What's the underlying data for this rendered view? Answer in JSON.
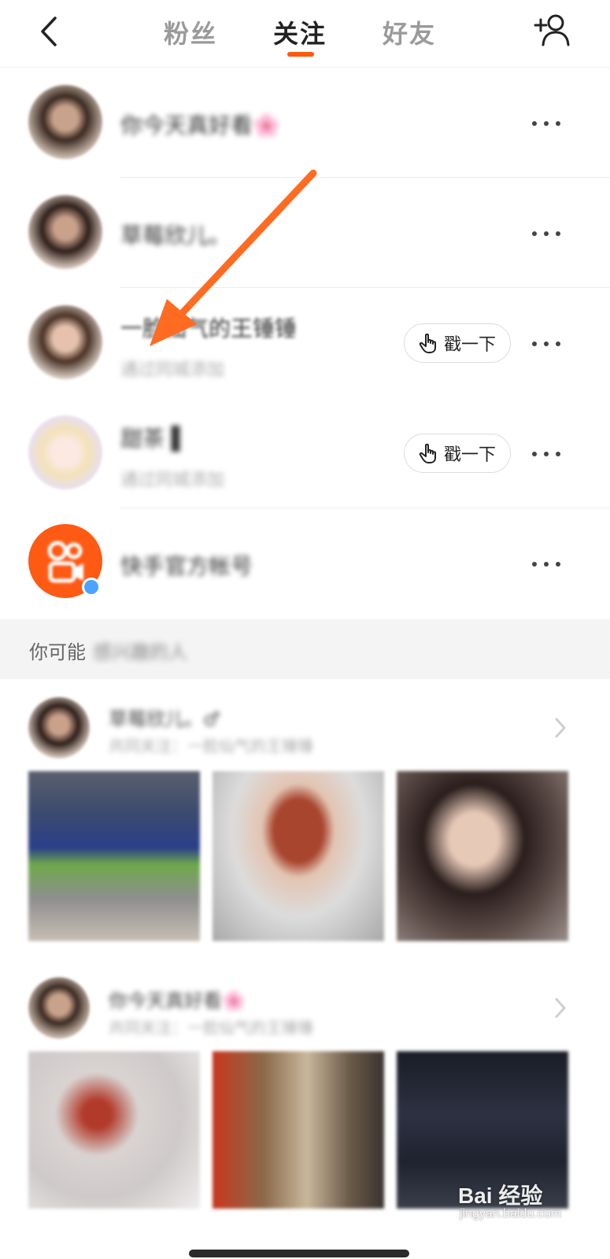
{
  "header": {
    "tabs": [
      {
        "label": "粉丝",
        "active": false
      },
      {
        "label": "关注",
        "active": true
      },
      {
        "label": "好友",
        "active": false
      }
    ],
    "accent_color": "#ff5a0e"
  },
  "following": [
    {
      "name": "你今天真好看🌸",
      "subtitle": "",
      "poke": false
    },
    {
      "name": "草莓欣儿。",
      "subtitle": "",
      "poke": false
    },
    {
      "name": "一脸仙气的王锤锤",
      "subtitle": "通过同城添加",
      "poke": true
    },
    {
      "name": "甜茶 ▌",
      "subtitle": "通过同城添加",
      "poke": true
    },
    {
      "name": "快手官方帐号",
      "subtitle": "",
      "poke": false
    }
  ],
  "poke_label": "戳一下",
  "suggestions": {
    "title_visible": "你可能",
    "title_blurred": "感兴趣的人",
    "users": [
      {
        "name": "草莓欣儿。♂",
        "subtitle": "共同关注：一脸仙气的王锤锤"
      },
      {
        "name": "你今天真好看🌸",
        "subtitle": "共同关注：一脸仙气的王锤锤"
      }
    ]
  },
  "watermark": {
    "text": "Bai 经验",
    "sub": "jingyan.baidu.com"
  },
  "icons": [
    "back-chevron-icon",
    "add-user-icon",
    "more-dots-icon",
    "tap-hand-icon",
    "chevron-right-icon"
  ]
}
